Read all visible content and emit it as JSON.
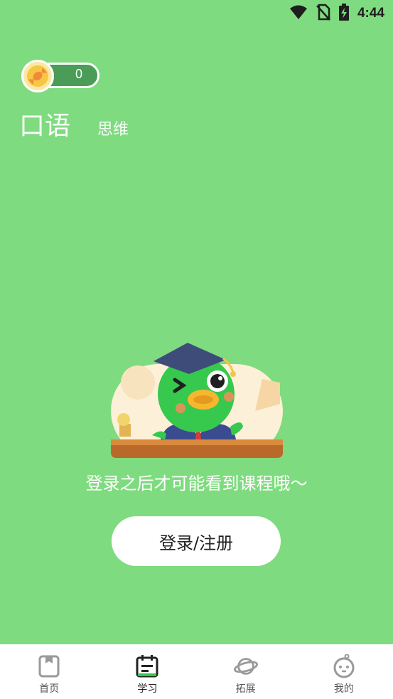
{
  "status_bar": {
    "time": "4:44"
  },
  "coins": {
    "count": "0"
  },
  "tabs": [
    {
      "label": "口语",
      "active": true
    },
    {
      "label": "思维",
      "active": false
    }
  ],
  "empty_state": {
    "message": "登录之后才可能看到课程哦～",
    "login_button": "登录/注册"
  },
  "bottom_nav": [
    {
      "label": "首页",
      "icon": "home-icon",
      "active": false
    },
    {
      "label": "学习",
      "icon": "calendar-icon",
      "active": true
    },
    {
      "label": "拓展",
      "icon": "planet-icon",
      "active": false
    },
    {
      "label": "我的",
      "icon": "face-icon",
      "active": false
    }
  ],
  "colors": {
    "background": "#7fdb7f",
    "accent_dark": "#4a9c57",
    "coin": "#fde8a3",
    "white": "#ffffff"
  }
}
